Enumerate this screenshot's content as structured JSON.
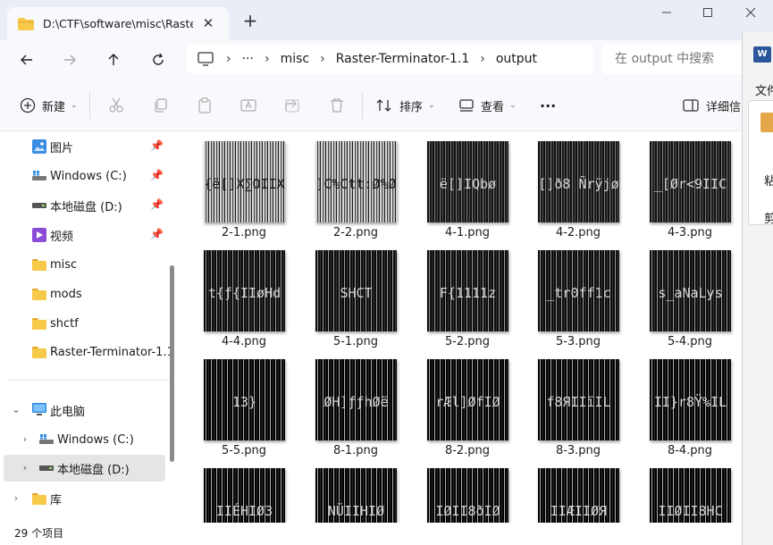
{
  "window": {
    "tab_title": "D:\\CTF\\software\\misc\\Raster-T",
    "new_tab_label": "+",
    "close_tab_label": "✕"
  },
  "address": {
    "overflow": "···",
    "crumbs": [
      "misc",
      "Raster-Terminator-1.1",
      "output"
    ],
    "search_placeholder": "在 output 中搜索"
  },
  "toolbar": {
    "new_label": "新建",
    "sort_label": "排序",
    "view_label": "查看",
    "more_label": "···",
    "details_label": "详细信"
  },
  "sidebar": {
    "quick": [
      {
        "label": "图片",
        "icon": "pictures-icon"
      },
      {
        "label": "Windows (C:)",
        "icon": "windows-drive-icon"
      },
      {
        "label": "本地磁盘 (D:)",
        "icon": "drive-icon"
      },
      {
        "label": "视频",
        "icon": "videos-icon"
      },
      {
        "label": "misc",
        "icon": "folder-icon"
      },
      {
        "label": "mods",
        "icon": "folder-icon"
      },
      {
        "label": "shctf",
        "icon": "folder-icon"
      },
      {
        "label": "Raster-Terminator-1.1",
        "icon": "folder-icon"
      }
    ],
    "this_pc": "此电脑",
    "drives": [
      "Windows (C:)",
      "本地磁盘 (D:)"
    ],
    "library": "库"
  },
  "files": [
    {
      "name": "2-1.png",
      "cap": "{ë[]X∑OIIX",
      "style": "light"
    },
    {
      "name": "2-2.png",
      "cap": "]C%Ctt:Ø%Ø",
      "style": "light"
    },
    {
      "name": "4-1.png",
      "cap": "ë[]IQbø",
      "style": "dark1"
    },
    {
      "name": "4-2.png",
      "cap": "[]ð8 Ñrÿjø",
      "style": "dark1"
    },
    {
      "name": "4-3.png",
      "cap": "_[Ør<9IIC",
      "style": "dark1"
    },
    {
      "name": "4-4.png",
      "cap": "t{ƒ{IIøHd",
      "style": "dark2"
    },
    {
      "name": "5-1.png",
      "cap": "    SHCT",
      "style": "dark2"
    },
    {
      "name": "5-2.png",
      "cap": "F{1111z",
      "style": "dark2"
    },
    {
      "name": "5-3.png",
      "cap": "_tr0ff1c",
      "style": "dark2"
    },
    {
      "name": "5-4.png",
      "cap": "s_aNaLys",
      "style": "dark2"
    },
    {
      "name": "5-5.png",
      "cap": "13}",
      "style": "dark3"
    },
    {
      "name": "8-1.png",
      "cap": "ØH]ƒƒhØë",
      "style": "dark3"
    },
    {
      "name": "8-2.png",
      "cap": "rÆl]ØfIØ",
      "style": "dark3"
    },
    {
      "name": "8-3.png",
      "cap": "f8ЯIIïIL",
      "style": "dark3"
    },
    {
      "name": "8-4.png",
      "cap": "II}r8Ÿ%IL",
      "style": "dark3"
    },
    {
      "name": "",
      "cap": "IIÉHIØ3",
      "style": "dark3"
    },
    {
      "name": "",
      "cap": "NÜIIHIØ",
      "style": "dark3"
    },
    {
      "name": "",
      "cap": "IØII8ðIØ",
      "style": "dark3"
    },
    {
      "name": "",
      "cap": "IIÆIIØЯ",
      "style": "dark3"
    },
    {
      "name": "",
      "cap": "IIØII8HC",
      "style": "dark3"
    }
  ],
  "status": {
    "item_count": "29 个项目"
  },
  "other_window": {
    "word_badge": "W",
    "file_label": "文件",
    "paste_label": "粘",
    "cut_label": "剪"
  }
}
